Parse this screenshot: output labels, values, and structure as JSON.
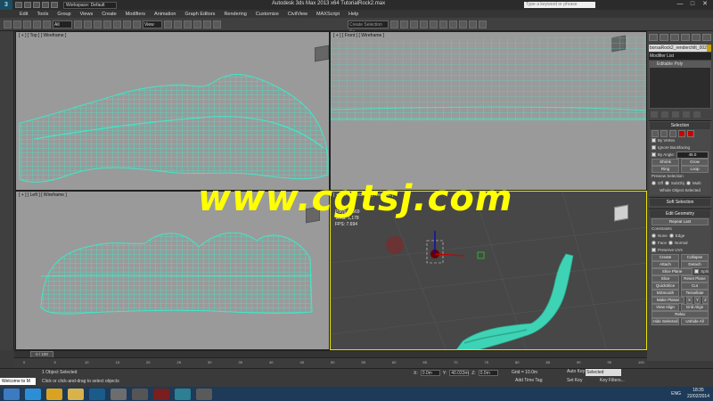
{
  "titlebar": {
    "workspace": "Workspace: Default",
    "title": "Autodesk 3ds Max  2013 x64     TutorialRock2.max",
    "search_placeholder": "Type a keyword or phrase",
    "minimize": "—",
    "maximize": "□",
    "close": "✕"
  },
  "menu": [
    "Edit",
    "Tools",
    "Group",
    "Views",
    "Create",
    "Modifiers",
    "Animation",
    "Graph Editors",
    "Rendering",
    "Customize",
    "CivilView",
    "MAXScript",
    "Help"
  ],
  "toolbar": {
    "filter": "All",
    "view": "View",
    "selection_set": "Create Selection Se"
  },
  "viewports": {
    "top": "[ + ] [ Top ] [ Wireframe ]",
    "front": "[ + ] [ Front ] [ Wireframe ]",
    "left": "[ + ] [ Left ] [ Wireframe ]",
    "persp": "[ + ] [ Perspective ] [ Realistic ]"
  },
  "stats": {
    "polys_label": "Polys:",
    "polys": "2,569",
    "verts_label": "Verts:",
    "verts": "1,178",
    "fps_label": "FPS:",
    "fps": "7.694"
  },
  "watermark": "www.cgtsj.com",
  "command_panel": {
    "object_name": "borsaRock2_renderchilt_002",
    "modifier_list": "Modifier List",
    "stack_item": "Editable Poly",
    "selection": {
      "title": "Selection",
      "by_vertex": "By Vertex",
      "ignore_backfacing": "Ignore Backfacing",
      "by_angle": "By Angle:",
      "angle": "45.0",
      "shrink": "Shrink",
      "grow": "Grow",
      "ring": "Ring",
      "loop": "Loop",
      "preview": "Preview Selection",
      "off": "Off",
      "subobj": "SubObj",
      "multi": "Multi",
      "whole": "Whole Object Selected"
    },
    "soft_selection": "Soft Selection",
    "edit_geometry": {
      "title": "Edit Geometry",
      "repeat_last": "Repeat Last",
      "constraints": "Constraints",
      "none": "None",
      "edge": "Edge",
      "face": "Face",
      "normal": "Normal",
      "preserve_uvs": "Preserve UVs",
      "create": "Create",
      "collapse": "Collapse",
      "attach": "Attach",
      "detach": "Detach",
      "slice_plane": "Slice Plane",
      "split": "Split",
      "slice": "Slice",
      "reset_plane": "Reset Plane",
      "quickslice": "QuickSlice",
      "cut": "Cut",
      "msmooth": "MSmooth",
      "tessellate": "Tessellate",
      "make_planar": "Make Planar",
      "x": "X",
      "y": "Y",
      "z": "Z",
      "view_align": "View Align",
      "grid_align": "Grid Align",
      "relax": "Relax",
      "hide_selected": "Hide Selected",
      "unhide_all": "Unhide All"
    }
  },
  "timeline": {
    "frame": "0 / 100",
    "ticks": [
      "0",
      "5",
      "10",
      "15",
      "20",
      "25",
      "30",
      "35",
      "40",
      "45",
      "50",
      "55",
      "60",
      "65",
      "70",
      "75",
      "80",
      "85",
      "90",
      "95",
      "100"
    ]
  },
  "status": {
    "maxscript": "Welcome to M",
    "object_selected": "1 Object Selected",
    "prompt": "Click or click-and-drag to select objects",
    "x_label": "X:",
    "x": "0.0m",
    "y_label": "Y:",
    "y": "40.033m",
    "z_label": "Z:",
    "z": "0.0m",
    "grid": "Grid = 10.0m",
    "add_time_tag": "Add Time Tag",
    "auto_key": "Auto Key",
    "set_key": "Set Key",
    "selected": "Selected",
    "key_filters": "Key Filters..."
  },
  "taskbar": {
    "lang": "ENG",
    "time": "18:35",
    "date": "22/02/2014"
  },
  "colors": {
    "wire": "#40e8c8",
    "persp_border": "#e4e400",
    "watermark": "#ffff00",
    "taskbar": "#1d3a58"
  }
}
